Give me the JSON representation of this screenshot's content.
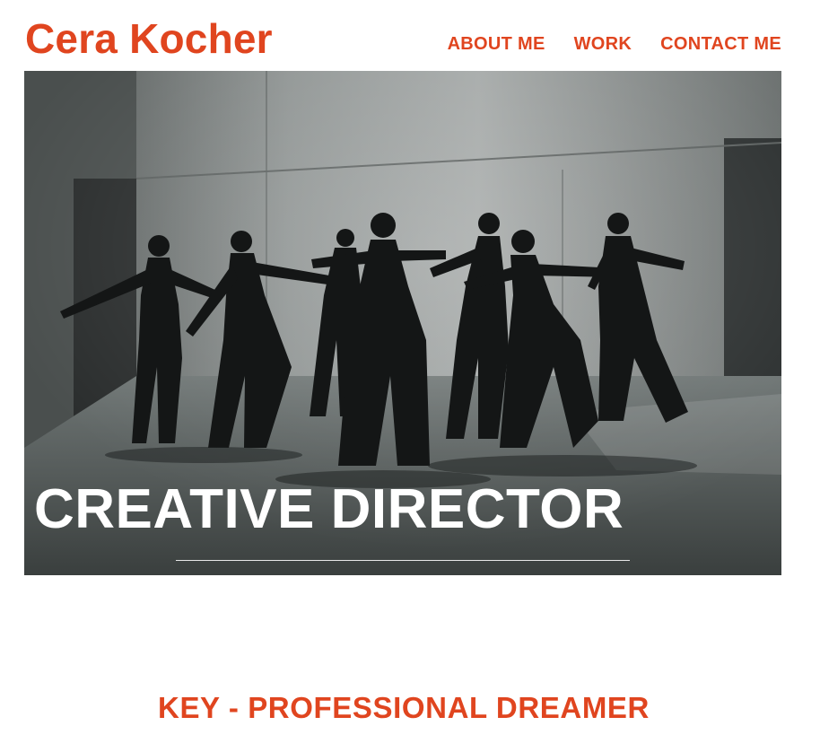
{
  "header": {
    "site_title": "Cera Kocher",
    "nav": [
      {
        "label": "ABOUT ME"
      },
      {
        "label": "WORK"
      },
      {
        "label": "CONTACT ME"
      }
    ]
  },
  "hero": {
    "image_icon": "dance-group-photo",
    "heading": "CREATIVE DIRECTOR"
  },
  "main": {
    "tagline": "KEY - PROFESSIONAL DREAMER"
  },
  "colors": {
    "accent": "#e0451f",
    "hero_text": "#ffffff"
  }
}
